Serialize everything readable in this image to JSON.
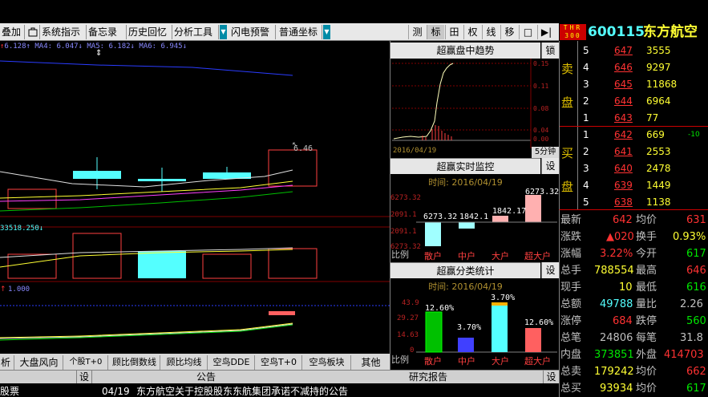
{
  "toolbar": {
    "items": [
      "叠加",
      "系统指示",
      "备忘录",
      "历史回忆",
      "分析工具",
      "闪电预警",
      "普通坐标"
    ],
    "right_buttons": [
      "测",
      "标",
      "田",
      "权",
      "线",
      "移",
      "□",
      "▶|"
    ],
    "bag_icon": "briefcase-icon"
  },
  "stock": {
    "badge_top": "THR",
    "badge_bottom": "300",
    "code": "600115",
    "name": "东方航空"
  },
  "chart": {
    "legend": "6.128↑ MA4: 6.047↓ MA5: 6.182↓ MA6: 6.945↓",
    "price_label": "6.46",
    "vol_legend": "33518.250↓",
    "ind_legend": "1.000"
  },
  "tabs": [
    "析",
    "大盘风向",
    "个股T+0",
    "顾比倒数线",
    "顾比均线",
    "空鸟DDE",
    "空鸟T+0",
    "空鸟板块",
    "其他"
  ],
  "bottom": {
    "settings": "设",
    "announce_header": "公告",
    "report_header": "研究报告",
    "settings2": "设",
    "left_row": "股票",
    "announce_date": "04/19",
    "announce_text": "东方航空关于控股股东东航集团承诺不减持的公告"
  },
  "trend": {
    "title": "超赢盘中趋势",
    "lock": "锁",
    "ylabels": [
      "0.15",
      "0.11",
      "0.08",
      "0.04",
      "0.00"
    ],
    "date": "2016/04/19",
    "period": "5分钟"
  },
  "monitor": {
    "title": "超赢实时监控",
    "settings": "设",
    "date_label": "时间: 2016/04/19",
    "ylabels": [
      "6273.32",
      "2091.1",
      "2091.1",
      "6273.32"
    ],
    "values": [
      "6273.32",
      "1842.1",
      "1842.17",
      "6273.32"
    ],
    "labels": [
      "比例",
      "散户",
      "中户",
      "大户",
      "超大户"
    ]
  },
  "classify": {
    "title": "超赢分类统计",
    "settings": "设",
    "date_label": "时间: 2016/04/19",
    "ylabels": [
      "43.9",
      "29.27",
      "14.63",
      "0"
    ],
    "values": [
      "12.60%",
      "3.70%",
      "3.70%",
      "12.60%"
    ],
    "labels": [
      "比例",
      "散户",
      "中户",
      "大户",
      "超大户"
    ]
  },
  "orderbook": {
    "sell_label": [
      "卖",
      "盘"
    ],
    "buy_label": [
      "买",
      "盘"
    ],
    "sell": [
      {
        "lvl": "5",
        "price": "647",
        "vol": "3555"
      },
      {
        "lvl": "4",
        "price": "646",
        "vol": "9297"
      },
      {
        "lvl": "3",
        "price": "645",
        "vol": "11868"
      },
      {
        "lvl": "2",
        "price": "644",
        "vol": "6964"
      },
      {
        "lvl": "1",
        "price": "643",
        "vol": "77"
      }
    ],
    "buy": [
      {
        "lvl": "1",
        "price": "642",
        "vol": "669",
        "chg": "-10"
      },
      {
        "lvl": "2",
        "price": "641",
        "vol": "2553",
        "chg": ""
      },
      {
        "lvl": "3",
        "price": "640",
        "vol": "2478",
        "chg": ""
      },
      {
        "lvl": "4",
        "price": "639",
        "vol": "1449",
        "chg": ""
      },
      {
        "lvl": "5",
        "price": "638",
        "vol": "1138",
        "chg": ""
      }
    ]
  },
  "quote": [
    {
      "l1": "最新",
      "v1": "642",
      "l2": "均价",
      "v2": "631"
    },
    {
      "l1": "涨跌",
      "v1": "▲020",
      "l2": "换手",
      "v2": "0.93%"
    },
    {
      "l1": "涨幅",
      "v1": "3.22%",
      "l2": "今开",
      "v2": "617"
    },
    {
      "l1": "总手",
      "v1": "788554",
      "l2": "最高",
      "v2": "646"
    },
    {
      "l1": "现手",
      "v1": "10",
      "l2": "最低",
      "v2": "616"
    },
    {
      "l1": "总额",
      "v1": "49788",
      "l2": "量比",
      "v2": "2.26"
    },
    {
      "l1": "涨停",
      "v1": "684",
      "l2": "跌停",
      "v2": "560"
    },
    {
      "l1": "总笔",
      "v1": "24806",
      "l2": "每笔",
      "v2": "31.8"
    },
    {
      "l1": "内盘",
      "v1": "373851",
      "l2": "外盘",
      "v2": "414703"
    },
    {
      "l1": "总卖",
      "v1": "179242",
      "l2": "均价",
      "v2": "662"
    },
    {
      "l1": "总买",
      "v1": "93934",
      "l2": "均价",
      "v2": "617"
    }
  ],
  "colors": {
    "up": "#ff3232",
    "down": "#00e600",
    "cyan": "#54ffff",
    "yellow": "#ffff33",
    "gold": "#e0c000"
  }
}
